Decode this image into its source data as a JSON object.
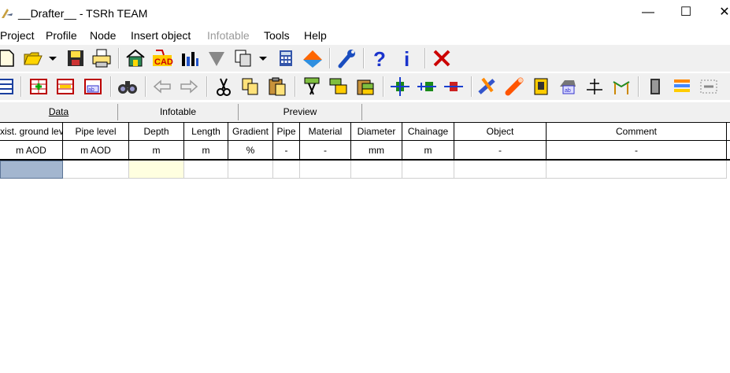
{
  "window": {
    "title": "__Drafter__ - TSRh TEAM",
    "minimize": "—",
    "maximize": "☐",
    "close": "✕"
  },
  "menu": [
    "Project",
    "Profile",
    "Node",
    "Insert object",
    "Infotable",
    "Tools",
    "Help"
  ],
  "menu_disabled": [
    "Infotable"
  ],
  "toolbar1": [
    "new-file-icon",
    "open-folder-icon",
    "dropdown-arrow-icon",
    "save-icon",
    "print-icon",
    "home-icon",
    "cad-icon",
    "bar-chart-icon",
    "filter-icon",
    "copy-pages-icon",
    "dropdown-arrow-icon",
    "calculator-icon",
    "mountain-icon",
    "wrench-icon",
    "help-question-icon",
    "info-icon",
    "close-red-icon"
  ],
  "toolbar2": [
    "table-icon",
    "table-add-icon",
    "table-edit-icon",
    "table-ab-icon",
    "binoculars-icon",
    "arrow-left-icon",
    "arrow-right-icon",
    "scissors-icon",
    "copy-icon",
    "paste-icon",
    "node-cut-icon",
    "node-copy-icon",
    "node-paste-icon",
    "insert-node-icon",
    "add-node-icon",
    "remove-node-icon",
    "pipe-cut-icon",
    "pipe-icon",
    "manhole-icon",
    "label-ab-icon",
    "level-icon",
    "profile-icon",
    "door-icon",
    "layers-icon",
    "pipe-select-icon"
  ],
  "tabs": [
    "Data",
    "Infotable",
    "Preview"
  ],
  "columns": [
    "xist. ground lev",
    "Pipe level",
    "Depth",
    "Length",
    "Gradient",
    "Pipe",
    "Material",
    "Diameter",
    "Chainage",
    "Object",
    "Comment"
  ],
  "units": [
    "m AOD",
    "m AOD",
    "m",
    "m",
    "%",
    "-",
    "-",
    "mm",
    "m",
    "-",
    "-"
  ],
  "colors": {
    "selected_cell": "#a3b6cf",
    "depth_cell": "#ffffe0",
    "close_red": "#cc0000",
    "help_blue": "#1a33cc"
  }
}
